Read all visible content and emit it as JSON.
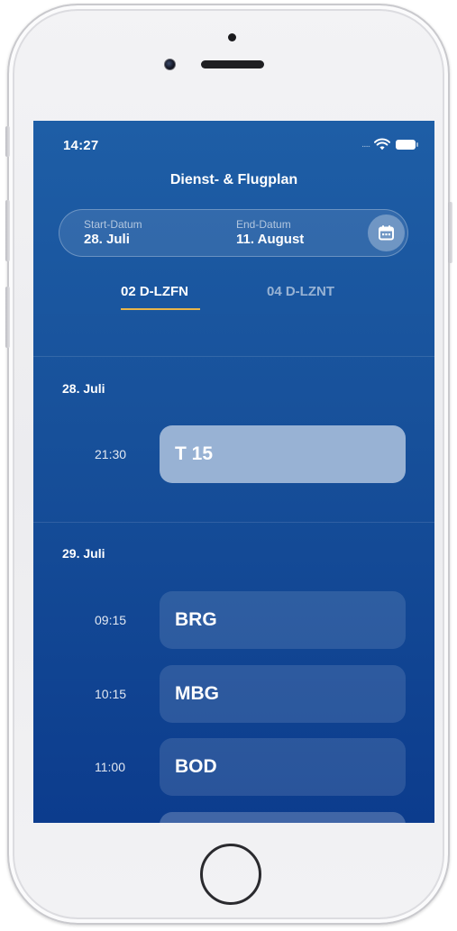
{
  "status_bar": {
    "time": "14:27",
    "signal_dots": "....."
  },
  "nav": {
    "title": "Dienst- & Flugplan"
  },
  "date_range": {
    "start_label": "Start-Datum",
    "start_value": "28. Juli",
    "end_label": "End-Datum",
    "end_value": "11. August",
    "calendar_icon": "calendar-icon"
  },
  "tabs": [
    {
      "label": "02 D-LZFN",
      "active": true
    },
    {
      "label": "04 D-LZNT",
      "active": false
    }
  ],
  "days": [
    {
      "label": "28. Juli",
      "flights": [
        {
          "time": "21:30",
          "code": "T 15",
          "highlighted": true
        }
      ]
    },
    {
      "label": "29. Juli",
      "flights": [
        {
          "time": "09:15",
          "code": "BRG",
          "highlighted": false
        },
        {
          "time": "10:15",
          "code": "MBG",
          "highlighted": false
        },
        {
          "time": "11:00",
          "code": "BOD",
          "highlighted": false
        }
      ]
    }
  ],
  "colors": {
    "screen_top": "#1e5ea6",
    "screen_bottom": "#0c3c8d",
    "tab_underline": "#e8b64b",
    "highlight_card": "#98b2d4"
  }
}
